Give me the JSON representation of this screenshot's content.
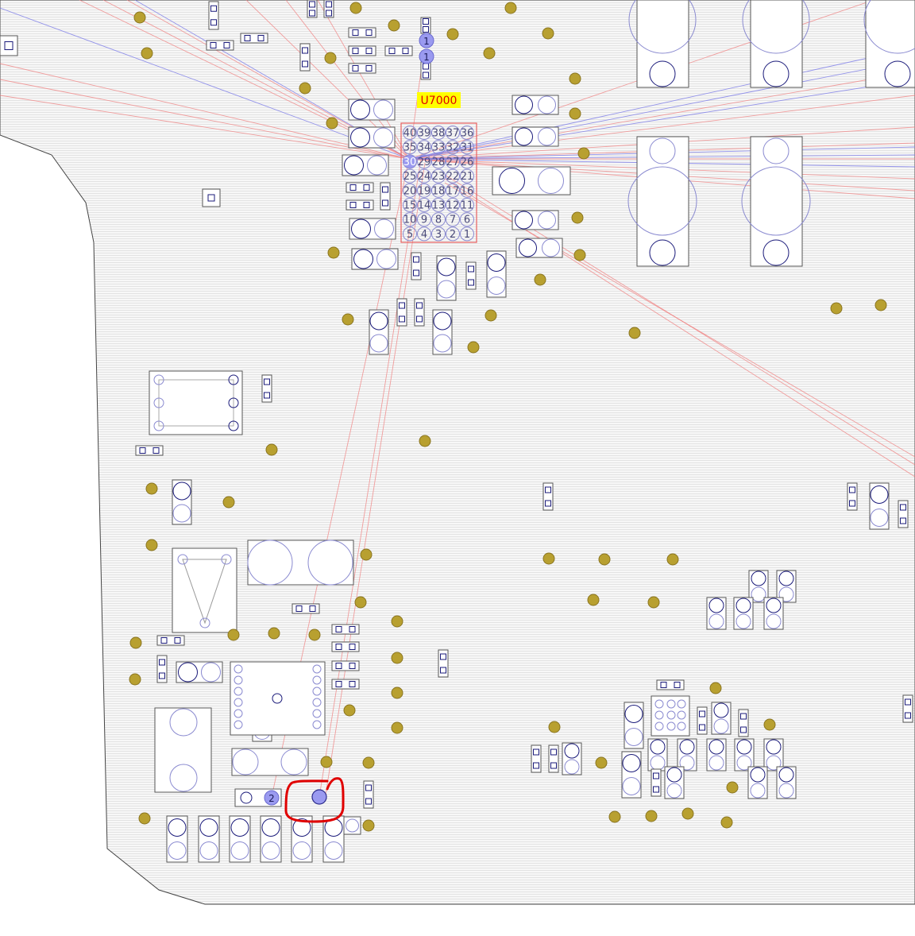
{
  "ic": {
    "ref": "U7000",
    "label_bg": "#ffff00",
    "label_color": "#e00000",
    "pins": [
      [
        "40",
        "39",
        "38",
        "37",
        "36"
      ],
      [
        "35",
        "34",
        "33",
        "32",
        "31"
      ],
      [
        "30",
        "29",
        "28",
        "27",
        "26"
      ],
      [
        "25",
        "24",
        "23",
        "22",
        "21"
      ],
      [
        "20",
        "19",
        "18",
        "17",
        "16"
      ],
      [
        "15",
        "14",
        "13",
        "12",
        "11"
      ],
      [
        "10",
        "9",
        "8",
        "7",
        "6"
      ],
      [
        "5",
        "4",
        "3",
        "2",
        "1"
      ]
    ],
    "highlighted_pin": "30"
  },
  "markers": {
    "pin1_top_a": "1",
    "pin1_top_b": "1",
    "pin2_bottom": "2"
  },
  "colors": {
    "board_fill": "#f6f6f6",
    "ratsnest_red": "#f08080",
    "ratsnest_blue": "#7a7ae8",
    "highlight_ring": "#e00000",
    "selected_pad": "#9a9af0",
    "via": "#b8a030"
  }
}
